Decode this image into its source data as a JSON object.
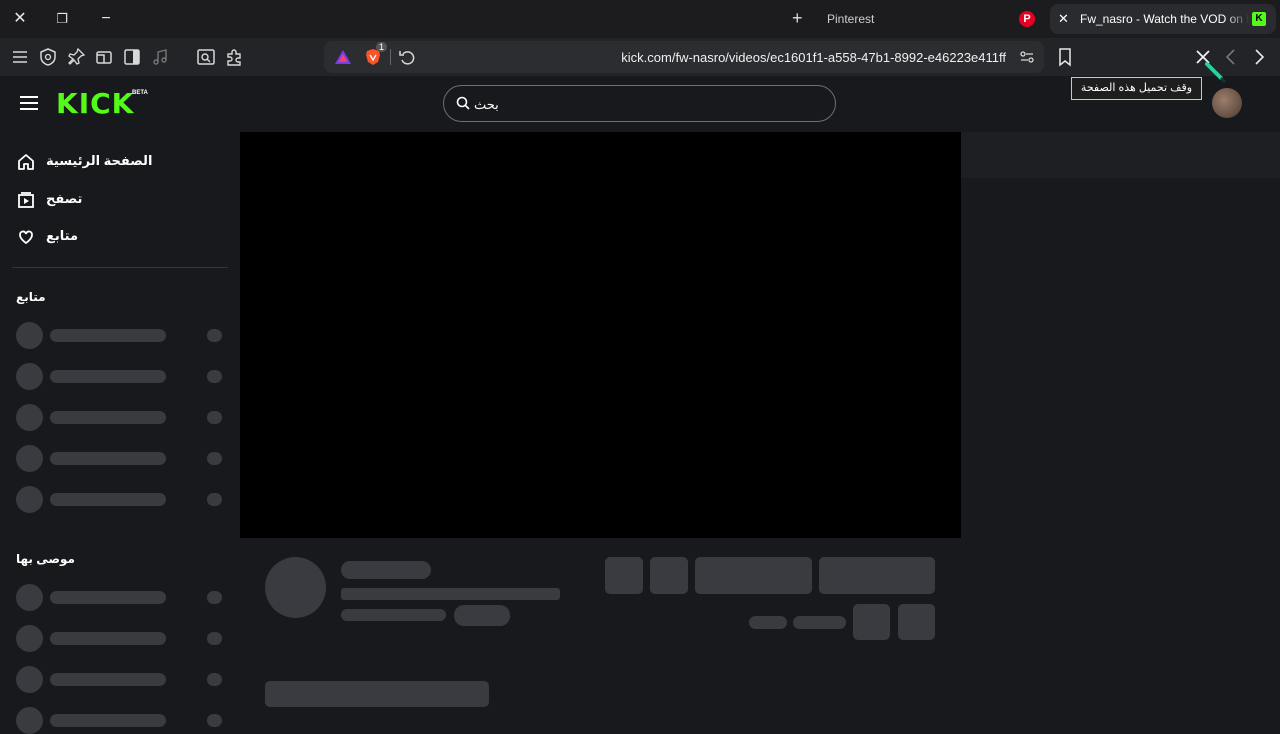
{
  "browser": {
    "tabs": [
      {
        "title": "Pinterest",
        "favicon": "P",
        "active": false
      },
      {
        "title": "Fw_nasro - Watch the VOD on Kick",
        "favicon": "K",
        "active": true
      }
    ],
    "address_bar": {
      "url": "kick.com/fw-nasro/videos/ec1601f1-a558-47b1-8992-e46223e411ff",
      "brave_shield_count": "1"
    },
    "tooltip": "وقف تحميل هذه الصفحة"
  },
  "header": {
    "logo_text": "KICK",
    "logo_badge": "BETA",
    "search_placeholder": "بحث"
  },
  "sidebar": {
    "nav": [
      {
        "label": "الصفحة الرئيسية",
        "icon": "home-icon"
      },
      {
        "label": "تصفح",
        "icon": "browse-icon"
      },
      {
        "label": "متابع",
        "icon": "heart-icon"
      }
    ],
    "following_title": "متابع",
    "recommended_title": "موصى بها"
  },
  "colors": {
    "accent": "#53fc18",
    "background": "#18191c",
    "skeleton": "#3a3b40"
  }
}
